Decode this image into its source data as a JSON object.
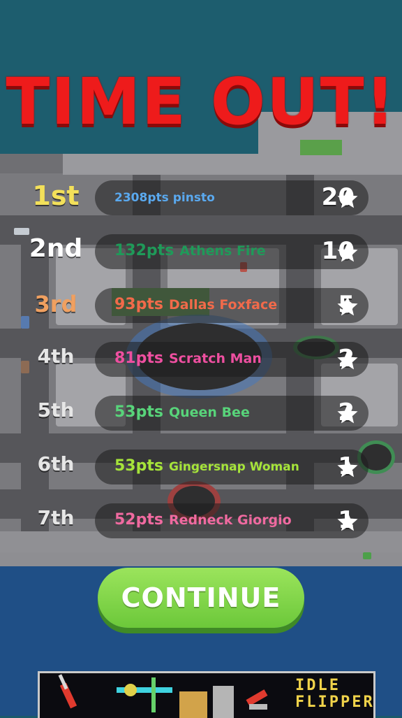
{
  "title": "TIME OUT!",
  "leaderboard": [
    {
      "rank": "1st",
      "rank_color": "#f3e05a",
      "points": "2308pts",
      "name": "pinsto",
      "text_color": "#5aa9ef",
      "stars": "20"
    },
    {
      "rank": "2nd",
      "rank_color": "#ffffff",
      "points": "132pts",
      "name": "Athens Fire",
      "text_color": "#1f9a59",
      "stars": "10"
    },
    {
      "rank": "3rd",
      "rank_color": "#f0a060",
      "points": "93pts",
      "name": "Dallas Foxface",
      "text_color": "#f26a4a",
      "stars": "5"
    },
    {
      "rank": "4th",
      "rank_color": "#e6e6e6",
      "points": "81pts",
      "name": "Scratch Man",
      "text_color": "#ee4fa0",
      "stars": "2"
    },
    {
      "rank": "5th",
      "rank_color": "#e6e6e6",
      "points": "53pts",
      "name": "Queen Bee",
      "text_color": "#58d47a",
      "stars": "2"
    },
    {
      "rank": "6th",
      "rank_color": "#e6e6e6",
      "points": "53pts",
      "name": "Gingersnap Woman",
      "text_color": "#a6e43a",
      "stars": "1"
    },
    {
      "rank": "7th",
      "rank_color": "#e6e6e6",
      "points": "52pts",
      "name": "Redneck Giorgio",
      "text_color": "#f06aa0",
      "stars": "1"
    }
  ],
  "star_icon": "star-icon",
  "continue_label": "CONTINUE",
  "ad": {
    "text_line1": "IDLE",
    "text_line2": "FLIPPER"
  }
}
